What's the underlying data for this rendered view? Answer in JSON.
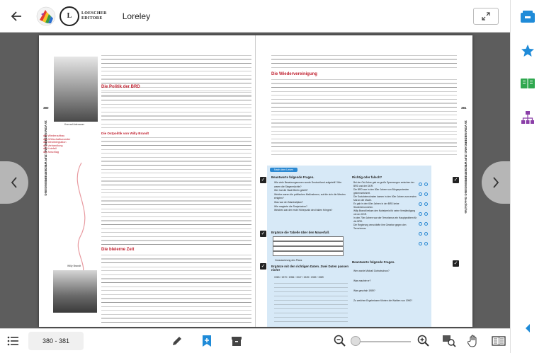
{
  "header": {
    "title": "Loreley",
    "publisher_line1": "LOESCHER",
    "publisher_line2": "EDITORE",
    "seal": "L"
  },
  "footer": {
    "page_indicator": "380 - 381"
  },
  "book": {
    "left_page_number": "380",
    "right_page_number": "381",
    "left_vertical_label": "15 VOM NIEDERGANG ZUR WIEDERVEREINIGUNG",
    "right_vertical_label": "15 VOM NIEDERGANG ZUR WIEDERVEREINIGUNG Geschichte",
    "headings": {
      "politik_brd": "Die Politik der BRD",
      "ostpolitik": "Die Ostpolitik von Willy Brandt",
      "bleierne_zeit": "Die bleierne Zeit",
      "wiedervereinigung": "Die Wiedervereinigung"
    },
    "captions": {
      "adenauer": "Konrad Adenauer",
      "brandt": "Willy Brandt"
    },
    "sidebar_terms": [
      "der Wiederaufbau",
      "das Wirtschaftswunder",
      "die Westintegration",
      "die Verhandlung",
      "die Kniefall",
      "der Anschlag"
    ],
    "exercise": {
      "tag": "Nach dem Lesen",
      "task1": "Beantworte folgende Fragen.",
      "task2": "Ergänze die Tabelle über den Mauerfall.",
      "task3": "Ergänze mit den richtigen Daten. Zwei Daten passen nicht!",
      "task4": "Richtig oder falsch?",
      "task5": "Beantworte folgende Fragen.",
      "table_rows": [
        "Wer fordert",
        "Warum",
        "Wann der Plan bestand",
        "Voraussetzung des Plans"
      ],
      "dates": "1963 / 1970 / 1956 / 1947 / 1949 / 1969 / 1989",
      "task4_items": [
        "Bei der Ost-Jahre gab es große Spannungen zwischen der BRD und der DDR.",
        "Die BRD war in den 80er Jahren von Bürgerprotesten gekennzeichnet.",
        "Die Sozialdemokraten kamen in den 60er Jahren zum ersten Mal an die Macht.",
        "Es gab in den 60er Jahren in der BRD keine Studentenunruhen.",
        "Willy Brandt bekam den Nobelpreis für seine Verständigung mit der DDR.",
        "In den 70er Jahren war der Terrorismus ein Hauptproblem für die BRD.",
        "Die Regierung verschärfte ihre Gesetze gegen den Terrorismus."
      ],
      "task1_items": [
        "Wie viele Besatzungszonen wurde Deutschland aufgeteilt? Wer waren die Siegermächte?",
        "Wer hat die Stadt Berlin geteilt?",
        "Welche waren die politischen Maßnahmen, auf die sich die Westen einigten?",
        "Was war der Marshallplan?",
        "Wie reagierte die Sowjetunion?",
        "Welches war der erste Höhepunkt des Kalten Krieges?"
      ],
      "task5_items": [
        "Wer wurde Michail Gorbatschow?",
        "Was machte er?",
        "Was geschah 1989?",
        "Zu welchen Ergebnissen führten die Wahlen von 1990?"
      ]
    }
  }
}
